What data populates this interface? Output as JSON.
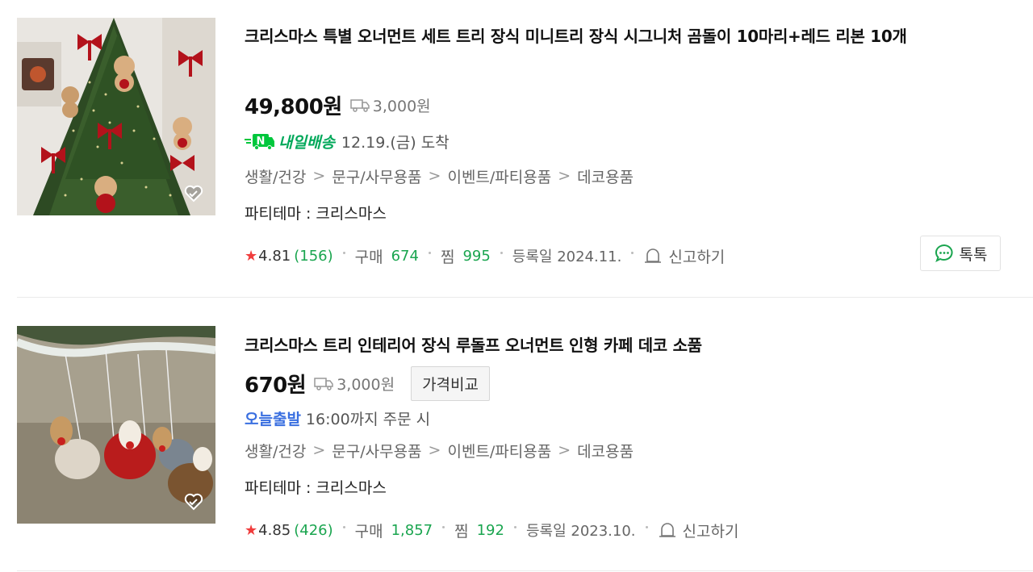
{
  "products": [
    {
      "title": "크리스마스 특별 오너먼트 세트 트리 장식 미니트리 장식 시그니처 곰돌이 10마리+레드 리본 10개",
      "price": "49,800원",
      "shipping": "3,000원",
      "delivery_badge": "내일배송",
      "delivery_text": "12.19.(금) 도착",
      "categories": [
        "생활/건강",
        "문구/사무용품",
        "이벤트/파티용품",
        "데코용품"
      ],
      "theme": "파티테마 : 크리스마스",
      "rating": "4.81",
      "review_count": "(156)",
      "purchase_label": "구매",
      "purchase_count": "674",
      "zzim_label": "찜",
      "zzim_count": "995",
      "registered": "등록일 2024.11.",
      "report_label": "신고하기",
      "talk_label": "톡톡"
    },
    {
      "title": "크리스마스 트리 인테리어 장식 루돌프 오너먼트 인형 카페 데코 소품",
      "price": "670원",
      "shipping": "3,000원",
      "compare_label": "가격비교",
      "delivery_badge": "오늘출발",
      "delivery_text": "16:00까지 주문 시",
      "categories": [
        "생활/건강",
        "문구/사무용품",
        "이벤트/파티용품",
        "데코용품"
      ],
      "theme": "파티테마 : 크리스마스",
      "rating": "4.85",
      "review_count": "(426)",
      "purchase_label": "구매",
      "purchase_count": "1,857",
      "zzim_label": "찜",
      "zzim_count": "192",
      "registered": "등록일 2023.10.",
      "report_label": "신고하기"
    }
  ],
  "icons": {
    "star": "★",
    "separator": ">",
    "zzim_icon": "heart-check-icon",
    "truck_icon": "truck-icon",
    "report_icon": "bell-icon",
    "talk_icon": "chat-bubble-icon",
    "naver_logo": "naver-n-truck-icon"
  },
  "colors": {
    "price_text": "#111111",
    "tomorrow_green": "#00a85a",
    "today_blue": "#3a6fe0",
    "count_green": "#1aa54f",
    "star_red": "#f03c3c"
  }
}
